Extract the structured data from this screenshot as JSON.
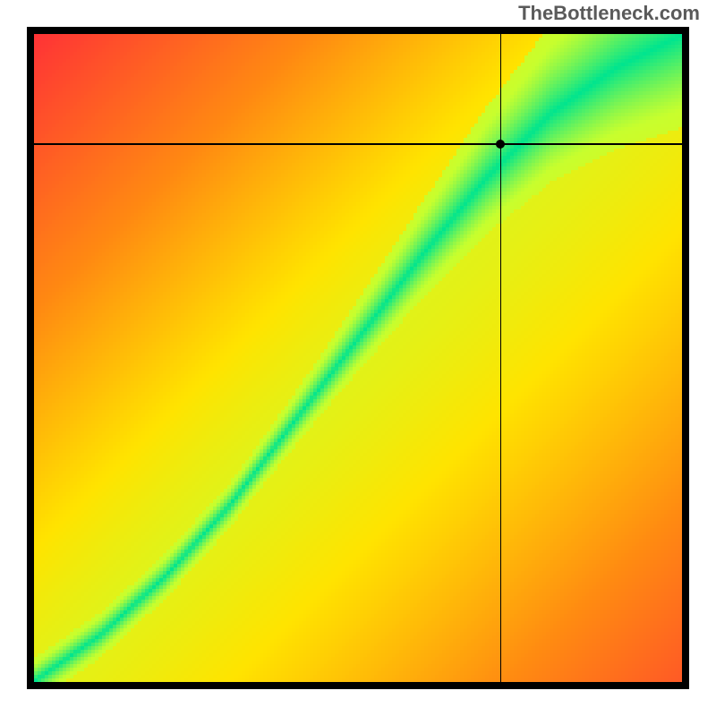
{
  "watermark": "TheBottleneck.com",
  "chart_data": {
    "type": "heatmap",
    "title": "",
    "xlabel": "",
    "ylabel": "",
    "xlim": [
      0,
      1
    ],
    "ylim": [
      0,
      1
    ],
    "axes_visible": false,
    "grid": false,
    "crosshair": {
      "x": 0.72,
      "y": 0.83
    },
    "marker": {
      "x": 0.72,
      "y": 0.83
    },
    "optimal_band": {
      "description": "Narrow green band where GPU and CPU are balanced; widens and bends near upper-right.",
      "approx_points_normalized": [
        {
          "x": 0.0,
          "y": 0.0
        },
        {
          "x": 0.1,
          "y": 0.07
        },
        {
          "x": 0.2,
          "y": 0.16
        },
        {
          "x": 0.3,
          "y": 0.27
        },
        {
          "x": 0.4,
          "y": 0.4
        },
        {
          "x": 0.5,
          "y": 0.53
        },
        {
          "x": 0.6,
          "y": 0.66
        },
        {
          "x": 0.7,
          "y": 0.78
        },
        {
          "x": 0.8,
          "y": 0.88
        },
        {
          "x": 0.9,
          "y": 0.95
        },
        {
          "x": 1.0,
          "y": 1.0
        }
      ]
    },
    "colormap": {
      "name": "red-yellow-green",
      "stops": [
        {
          "value": 0.0,
          "color": "#ff2a3a"
        },
        {
          "value": 0.35,
          "color": "#ff8a12"
        },
        {
          "value": 0.6,
          "color": "#ffe400"
        },
        {
          "value": 0.82,
          "color": "#c8ff2e"
        },
        {
          "value": 1.0,
          "color": "#00e58f"
        }
      ]
    },
    "field_description": "Score = 1 - clamp(|y - ridge(x)| / bandwidth(x)) with smooth gradient; higher = better balance."
  }
}
